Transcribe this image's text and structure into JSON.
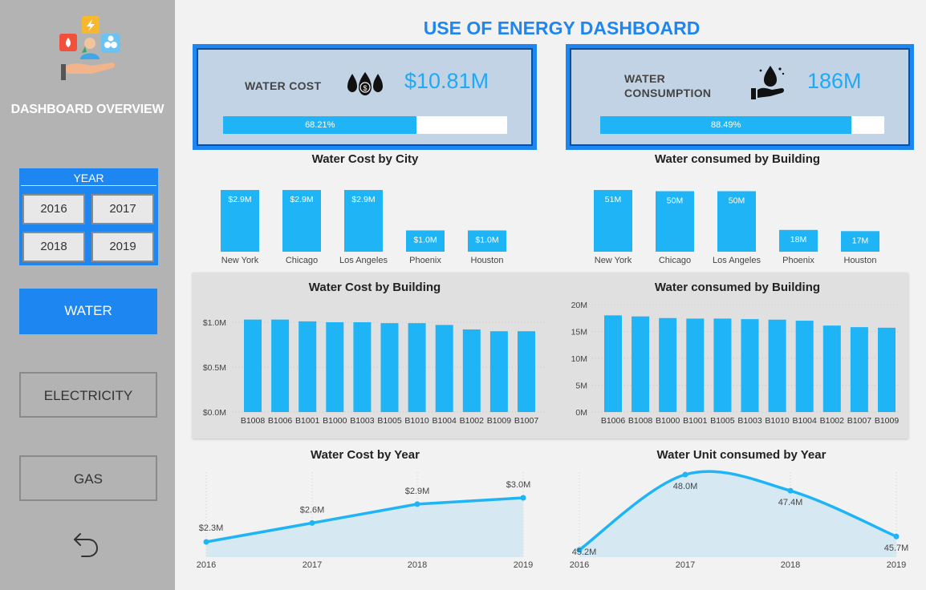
{
  "sidebar": {
    "title": "DASHBOARD OVERVIEW",
    "year_title": "YEAR",
    "years": [
      "2016",
      "2017",
      "2018",
      "2019"
    ],
    "nav": [
      "WATER",
      "ELECTRICITY",
      "GAS"
    ],
    "active_nav": "WATER"
  },
  "header": {
    "title": "USE OF ENERGY DASHBOARD"
  },
  "kpis": {
    "cost": {
      "label": "WATER COST",
      "value": "$10.81M",
      "pct_label": "68.21%",
      "pct": 0.6821
    },
    "consumption": {
      "label_line1": "WATER",
      "label_line2": "CONSUMPTION",
      "value": "186M",
      "pct_label": "88.49%",
      "pct": 0.8849
    }
  },
  "colors": {
    "accent": "#1e86f0",
    "bar": "#1eb4f5",
    "kpi_bg": "#c2d3e6",
    "sidebar": "#b3b3b3"
  },
  "chart_data": [
    {
      "id": "cost_city",
      "type": "bar",
      "title": "Water Cost by City",
      "categories": [
        "New York",
        "Chicago",
        "Los Angeles",
        "Phoenix",
        "Houston"
      ],
      "values": [
        2.9,
        2.9,
        2.9,
        1.0,
        1.0
      ],
      "labels": [
        "$2.9M",
        "$2.9M",
        "$2.9M",
        "$1.0M",
        "$1.0M"
      ],
      "ylim": [
        0,
        2.9
      ]
    },
    {
      "id": "consumed_city",
      "type": "bar",
      "title": "Water consumed by Building",
      "categories": [
        "New York",
        "Chicago",
        "Los Angeles",
        "Phoenix",
        "Houston"
      ],
      "values": [
        51,
        50,
        50,
        18,
        17
      ],
      "labels": [
        "51M",
        "50M",
        "50M",
        "18M",
        "17M"
      ],
      "ylim": [
        0,
        51
      ]
    },
    {
      "id": "cost_building",
      "type": "bar",
      "title": "Water Cost by Building",
      "categories": [
        "B1008",
        "B1006",
        "B1001",
        "B1000",
        "B1003",
        "B1005",
        "B1010",
        "B1004",
        "B1002",
        "B1009",
        "B1007"
      ],
      "values": [
        1.03,
        1.03,
        1.01,
        1.0,
        1.0,
        0.99,
        0.99,
        0.97,
        0.92,
        0.9,
        0.9
      ],
      "yticks": [
        "$0.0M",
        "$0.5M",
        "$1.0M"
      ],
      "ylim": [
        0,
        1.0
      ]
    },
    {
      "id": "consumed_building",
      "type": "bar",
      "title": "Water consumed by Building",
      "categories": [
        "B1006",
        "B1008",
        "B1000",
        "B1001",
        "B1005",
        "B1003",
        "B1010",
        "B1004",
        "B1002",
        "B1007",
        "B1009"
      ],
      "values": [
        18.0,
        17.8,
        17.5,
        17.4,
        17.4,
        17.3,
        17.2,
        17.0,
        16.1,
        15.8,
        15.7
      ],
      "yticks": [
        "0M",
        "5M",
        "10M",
        "15M",
        "20M"
      ],
      "ylim": [
        0,
        20
      ]
    },
    {
      "id": "cost_year",
      "type": "area",
      "title": "Water Cost by Year",
      "categories": [
        "2016",
        "2017",
        "2018",
        "2019"
      ],
      "values": [
        2.3,
        2.6,
        2.9,
        3.0
      ],
      "labels": [
        "$2.3M",
        "$2.6M",
        "$2.9M",
        "$3.0M"
      ]
    },
    {
      "id": "unit_year",
      "type": "area",
      "title": "Water Unit consumed by Year",
      "categories": [
        "2016",
        "2017",
        "2018",
        "2019"
      ],
      "values": [
        45.2,
        48.0,
        47.4,
        45.7
      ],
      "labels": [
        "45.2M",
        "48.0M",
        "47.4M",
        "45.7M"
      ]
    }
  ]
}
